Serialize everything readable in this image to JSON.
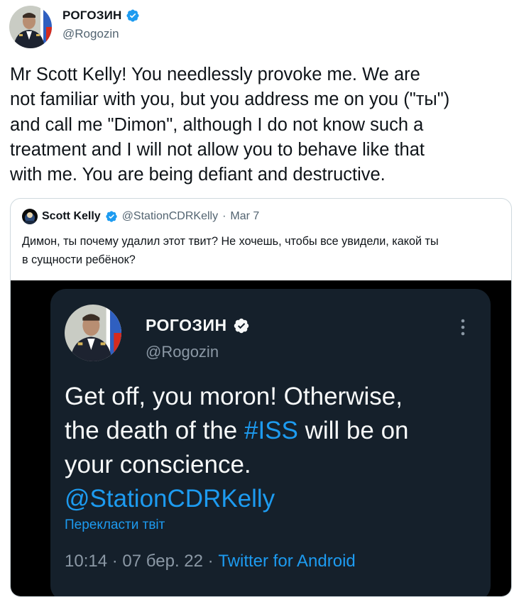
{
  "tweet": {
    "author_name": "РОГОЗИН",
    "author_handle": "@Rogozin",
    "text_lines": [
      "Mr Scott Kelly!  You needlessly provoke me.  We are",
      "not familiar with you, but you address me on you (\"ты\")",
      "and call me \"Dimon\", although I do not know such a",
      "treatment and I will not allow you to behave like that",
      "with me.  You are being defiant and destructive."
    ]
  },
  "quoted": {
    "author_name": "Scott Kelly",
    "author_handle": "@StationCDRKelly",
    "separator": "·",
    "date": "Mar 7",
    "text_lines": [
      "Димон, ты почему удалил этот твит? Не хочешь, чтобы все увидели, какой ты",
      "в сущности ребёнок?"
    ],
    "media": {
      "author_name": "РОГОЗИН",
      "author_handle": "@Rogozin",
      "text_line1": "Get off, you moron!  Otherwise,",
      "text_line2_before": "the death of the ",
      "text_line2_hashtag": "#ISS",
      "text_line2_after": " will be on",
      "text_line3": "your conscience.",
      "mention": "@StationCDRKelly",
      "translate_label": "Перекласти твіт",
      "time": "10:14",
      "date": "07 бер. 22",
      "source": "Twitter for Android"
    }
  },
  "colors": {
    "accent": "#1d9bf0",
    "dark_card": "#15202b",
    "secondary_text": "#536471"
  },
  "icons": [
    "verified-badge-icon",
    "more-options-icon"
  ]
}
